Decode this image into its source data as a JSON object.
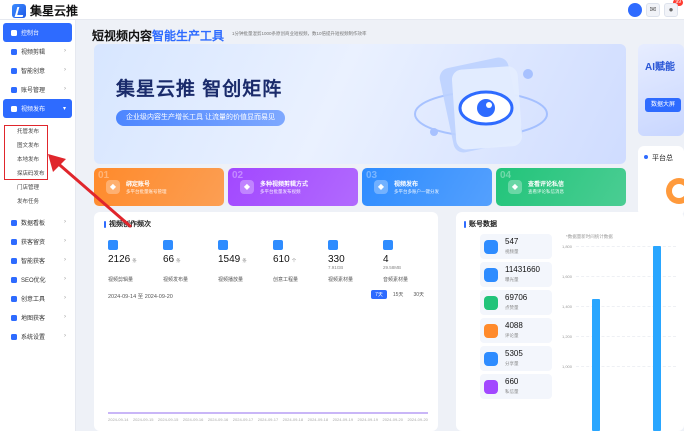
{
  "app": {
    "title": "集星云推"
  },
  "topbar": {
    "badge_count": "99"
  },
  "sidebar": {
    "items": [
      {
        "label": "控制台",
        "state": "active"
      },
      {
        "label": "视频剪辑"
      },
      {
        "label": "智能创意"
      },
      {
        "label": "账号管理"
      },
      {
        "label": "视频发布",
        "state": "open"
      }
    ],
    "sub_items": [
      "托管发布",
      "图文发布",
      "本地发布",
      "探店码发布",
      "门店管理",
      "发布任务"
    ],
    "more_items": [
      "数据看板",
      "获客留资",
      "智能获客",
      "SEO优化",
      "创意工具",
      "地图获客",
      "系统设置"
    ]
  },
  "page": {
    "title_prefix": "短视频内容",
    "title_highlight": "智能生产工具",
    "subtitle": "1分钟批量混剪1000条原创商业短视频，数10倍提升短视频制作效率"
  },
  "hero": {
    "title": "集星云推  智创矩阵",
    "pill": "企业级内容生产增长工具   让流量的价值显而易见"
  },
  "side_card": {
    "title": "AI赋能",
    "button": "数据大屏"
  },
  "side_card2": {
    "title": "平台总"
  },
  "features": [
    {
      "num": "01",
      "title": "绑定账号",
      "desc": "多平台批量账号管理",
      "color": "#ff8a2b"
    },
    {
      "num": "02",
      "title": "多种视频剪辑方式",
      "desc": "多平台批量发布视频",
      "color": "#a248ff"
    },
    {
      "num": "03",
      "title": "视频发布",
      "desc": "多平台多账户一键分发",
      "color": "#2e8cff"
    },
    {
      "num": "04",
      "title": "查看评论私信",
      "desc": "查看评论私信消息",
      "color": "#22c47a"
    }
  ],
  "stats_panel": {
    "title": "视频创作频次",
    "stats": [
      {
        "value": "2126",
        "unit": "条",
        "sub": "",
        "label": "视频剪辑量",
        "icon": "film-icon"
      },
      {
        "value": "66",
        "unit": "条",
        "sub": "",
        "label": "视频发布量",
        "icon": "send-icon"
      },
      {
        "value": "1549",
        "unit": "条",
        "sub": "",
        "label": "视频播放量",
        "icon": "play-icon"
      },
      {
        "value": "610",
        "unit": "个",
        "sub": "",
        "label": "创意工程量",
        "icon": "project-icon"
      },
      {
        "value": "330",
        "unit": "",
        "sub": "7.91GB",
        "label": "视频素材量",
        "icon": "video-asset-icon"
      },
      {
        "value": "4",
        "unit": "",
        "sub": "29.58MB",
        "label": "音频素材量",
        "icon": "audio-icon"
      }
    ],
    "date_range": "2024-09-14 至 2024-09-20",
    "range_tabs": [
      "7天",
      "15天",
      "30天"
    ],
    "x_ticks": [
      "2024-09-14",
      "2024-09-15",
      "2024-09-15",
      "2024-09-16",
      "2024-09-16",
      "2024-09-17",
      "2024-09-17",
      "2024-09-18",
      "2024-09-18",
      "2024-09-19",
      "2024-09-19",
      "2024-09-20",
      "2024-09-20"
    ]
  },
  "account_panel": {
    "title": "账号数据",
    "note": "*数据量新时间统计数据",
    "items": [
      {
        "value": "547",
        "label": "视频量",
        "color": "#2e8cff"
      },
      {
        "value": "11431660",
        "label": "曝光量",
        "color": "#2e8cff"
      },
      {
        "value": "69706",
        "label": "点赞量",
        "color": "#22c47a"
      },
      {
        "value": "4088",
        "label": "评论量",
        "color": "#ff8a2b"
      },
      {
        "value": "5305",
        "label": "分享量",
        "color": "#2e8cff"
      },
      {
        "value": "660",
        "label": "私信量",
        "color": "#a248ff"
      }
    ],
    "y_ticks": [
      "1,800",
      "1,600",
      "1,400",
      "1,200",
      "1,000"
    ],
    "bars": [
      0.62,
      1.0
    ]
  }
}
